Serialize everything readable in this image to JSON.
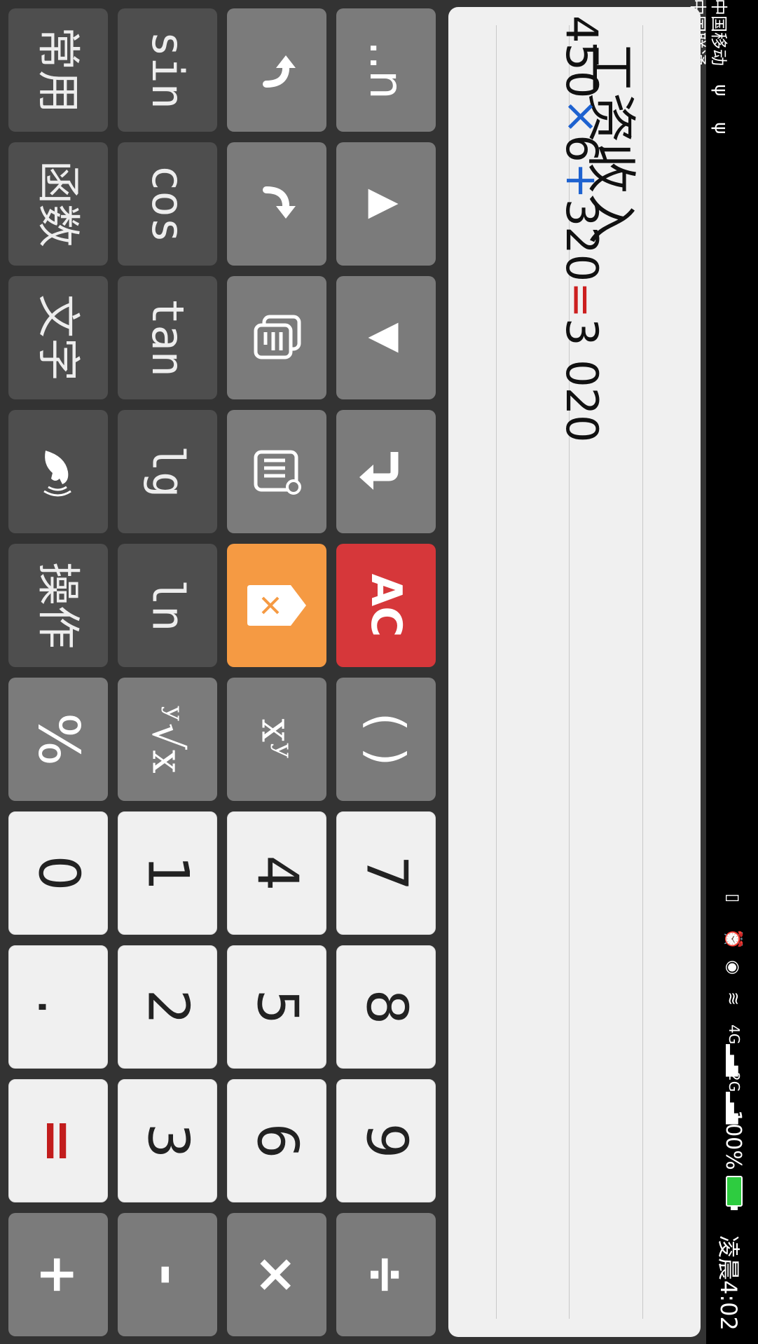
{
  "status_bar": {
    "carriers": [
      "中国移动",
      "中国联通"
    ],
    "usb_icons": [
      "usb-icon",
      "usb-icon"
    ],
    "icons": [
      "vibrate-icon",
      "alarm-icon",
      "eye-icon",
      "wifi-icon"
    ],
    "signal_4g_label": "4G",
    "signal_2g_label": "2G",
    "battery_percent": "100%",
    "battery_level": 1.0,
    "battery_color": "#2ecc40",
    "time": "凌晨4:02"
  },
  "display": {
    "title": "工资收入",
    "expression": {
      "a": "450",
      "op1": "×",
      "b": "6",
      "op2": "+",
      "c": "320",
      "eq": "=",
      "result": "3 020"
    },
    "colors": {
      "operator": "#1e62d0",
      "equals": "#cc1e1e"
    }
  },
  "keypad": {
    "col0": [
      "常用",
      "函数",
      "文字",
      "voice-icon",
      "操作",
      "%",
      "0",
      ".",
      "=",
      "+"
    ],
    "col1": [
      "sin",
      "cos",
      "tan",
      "lg",
      "ln",
      "ʸ√x",
      "1",
      "2",
      "3",
      "-"
    ],
    "col2": [
      "undo-icon",
      "redo-icon",
      "copy-icon",
      "paste-icon",
      "backspace-icon",
      "xʸ",
      "4",
      "5",
      "6",
      "×"
    ],
    "col3": [
      "..n",
      "▲",
      "▼",
      "enter-icon",
      "AC",
      "( )",
      "7",
      "8",
      "9",
      "÷"
    ],
    "colors": {
      "backspace": "#f59a43",
      "clear": "#d6373a",
      "dark": "#4e4e4e",
      "mid": "#7b7b7b",
      "light": "#f0f0f0"
    }
  }
}
